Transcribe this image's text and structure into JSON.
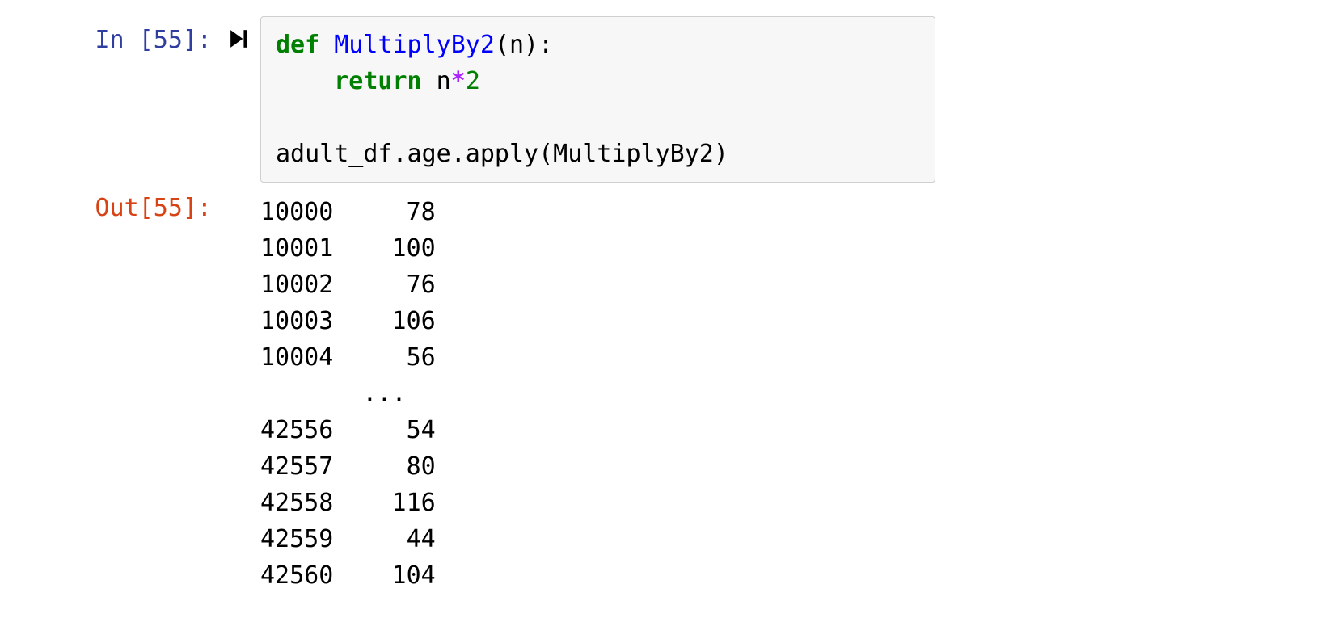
{
  "cell": {
    "in_prompt": "In [55]:",
    "out_prompt": "Out[55]:",
    "code": {
      "line1_def": "def",
      "line1_space": " ",
      "line1_fn": "MultiplyBy2",
      "line1_rest": "(n):",
      "line2_indent": "    ",
      "line2_return": "return",
      "line2_space": " n",
      "line2_star": "*",
      "line2_num": "2",
      "line3_blank": "",
      "line4": "adult_df.age.apply(MultiplyBy2)"
    },
    "output_rows": [
      {
        "index": "10000",
        "value": "78"
      },
      {
        "index": "10001",
        "value": "100"
      },
      {
        "index": "10002",
        "value": "76"
      },
      {
        "index": "10003",
        "value": "106"
      },
      {
        "index": "10004",
        "value": "56"
      }
    ],
    "output_ellipsis": "       ... ",
    "output_rows_tail": [
      {
        "index": "42556",
        "value": "54"
      },
      {
        "index": "42557",
        "value": "80"
      },
      {
        "index": "42558",
        "value": "116"
      },
      {
        "index": "42559",
        "value": "44"
      },
      {
        "index": "42560",
        "value": "104"
      }
    ]
  }
}
